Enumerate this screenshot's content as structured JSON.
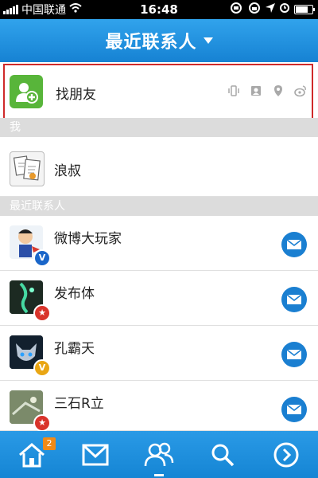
{
  "status_bar": {
    "carrier": "中国联通",
    "time": "16:48",
    "battery_level": 0.85,
    "icons": [
      "signal-icon",
      "wifi-icon",
      "headset-icon",
      "lock-rotation-icon",
      "location-icon",
      "alarm-icon",
      "battery-icon"
    ]
  },
  "nav": {
    "title": "最近联系人",
    "caret_icon": "chevron-down-icon"
  },
  "find_friends": {
    "label": "找朋友",
    "icon": "add-user-icon",
    "tools": [
      "phone-shake-icon",
      "contacts-card-icon",
      "location-pin-icon",
      "weibo-icon"
    ]
  },
  "sections": {
    "me": "我",
    "recent": "最近联系人"
  },
  "me_contact": {
    "name": "浪叔"
  },
  "contacts": [
    {
      "name": "微博大玩家",
      "badge": "V",
      "badge_color": "#1a66c9"
    },
    {
      "name": "发布体",
      "badge": "★",
      "badge_color": "#d9342b"
    },
    {
      "name": "孔霸天",
      "badge": "V",
      "badge_color": "#e9a614"
    },
    {
      "name": "三石R立",
      "badge": "★",
      "badge_color": "#d9342b"
    }
  ],
  "tabs": {
    "home_count": "2",
    "items": [
      "home-icon",
      "messages-icon",
      "contacts-icon",
      "search-icon",
      "more-icon"
    ]
  },
  "colors": {
    "brand_blue": "#1e8fdc",
    "highlight_border": "#cf2a2a",
    "section_gray": "#dcdcdc"
  }
}
